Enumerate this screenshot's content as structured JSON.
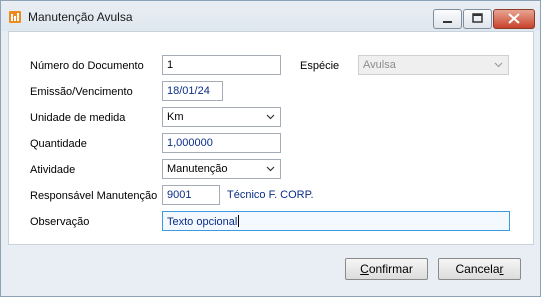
{
  "window": {
    "title": "Manutenção Avulsa",
    "icon": "app-logo-icon"
  },
  "controls": {
    "minimize_icon": "minimize-icon",
    "maximize_icon": "maximize-icon",
    "close_icon": "close-icon",
    "close_color": "#c7432c"
  },
  "form": {
    "numero_documento": {
      "label": "Número do Documento",
      "value": "1"
    },
    "especie": {
      "label": "Espécie",
      "value": "Avulsa"
    },
    "emissao": {
      "label": "Emissão/Vencimento",
      "value": "18/01/24"
    },
    "unidade": {
      "label": "Unidade de medida",
      "value": "Km"
    },
    "quantidade": {
      "label": "Quantidade",
      "value": "1,000000"
    },
    "atividade": {
      "label": "Atividade",
      "value": "Manutenção"
    },
    "responsavel": {
      "label": "Responsável Manutenção",
      "code": "9001",
      "name": "Técnico F. CORP."
    },
    "observacao": {
      "label": "Observação",
      "value": "Texto opcional"
    }
  },
  "buttons": {
    "confirm_prefix": "C",
    "confirm_rest": "onfirmar",
    "cancel_prefix": "Cancela",
    "cancel_underline": "r"
  }
}
